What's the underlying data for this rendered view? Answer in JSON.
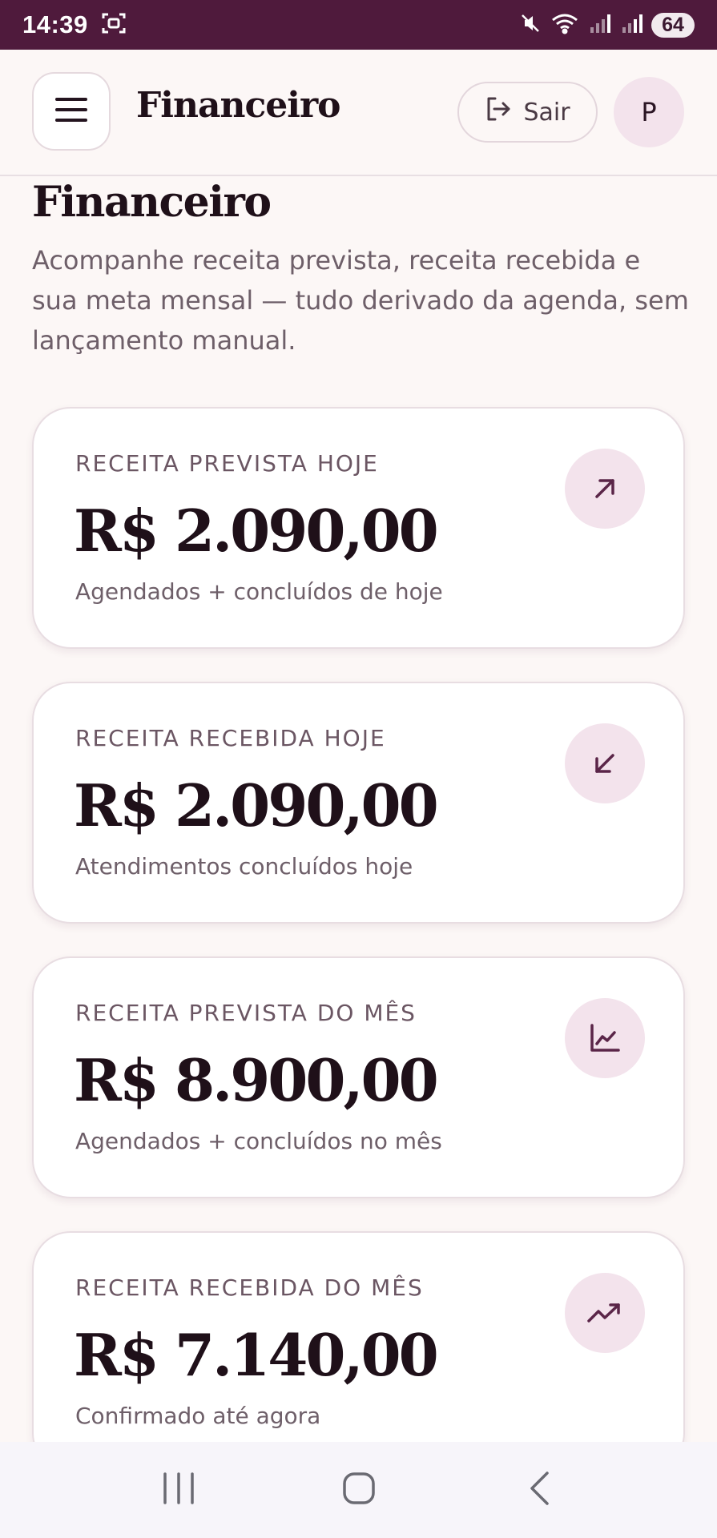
{
  "status_bar": {
    "time": "14:39",
    "battery": "64"
  },
  "header": {
    "title": "Financeiro",
    "logout_label": "Sair",
    "avatar_initial": "P"
  },
  "page": {
    "title": "Financeiro",
    "description": "Acompanhe receita prevista, receita recebida e sua meta mensal — tudo derivado da agenda, sem lançamento manual."
  },
  "cards": [
    {
      "label": "RECEITA PREVISTA HOJE",
      "value": "R$ 2.090,00",
      "subtitle": "Agendados + concluídos de hoje",
      "icon": "arrow-up-right-icon"
    },
    {
      "label": "RECEITA RECEBIDA HOJE",
      "value": "R$ 2.090,00",
      "subtitle": "Atendimentos concluídos hoje",
      "icon": "arrow-down-left-icon"
    },
    {
      "label": "RECEITA PREVISTA DO MÊS",
      "value": "R$ 8.900,00",
      "subtitle": "Agendados + concluídos no mês",
      "icon": "line-chart-icon"
    },
    {
      "label": "RECEITA RECEBIDA DO MÊS",
      "value": "R$ 7.140,00",
      "subtitle": "Confirmado até agora",
      "icon": "trending-up-icon"
    }
  ],
  "colors": {
    "status_bar": "#4f1a3c",
    "accent_bg": "#f3e3ec",
    "icon_stroke": "#5a2548"
  }
}
